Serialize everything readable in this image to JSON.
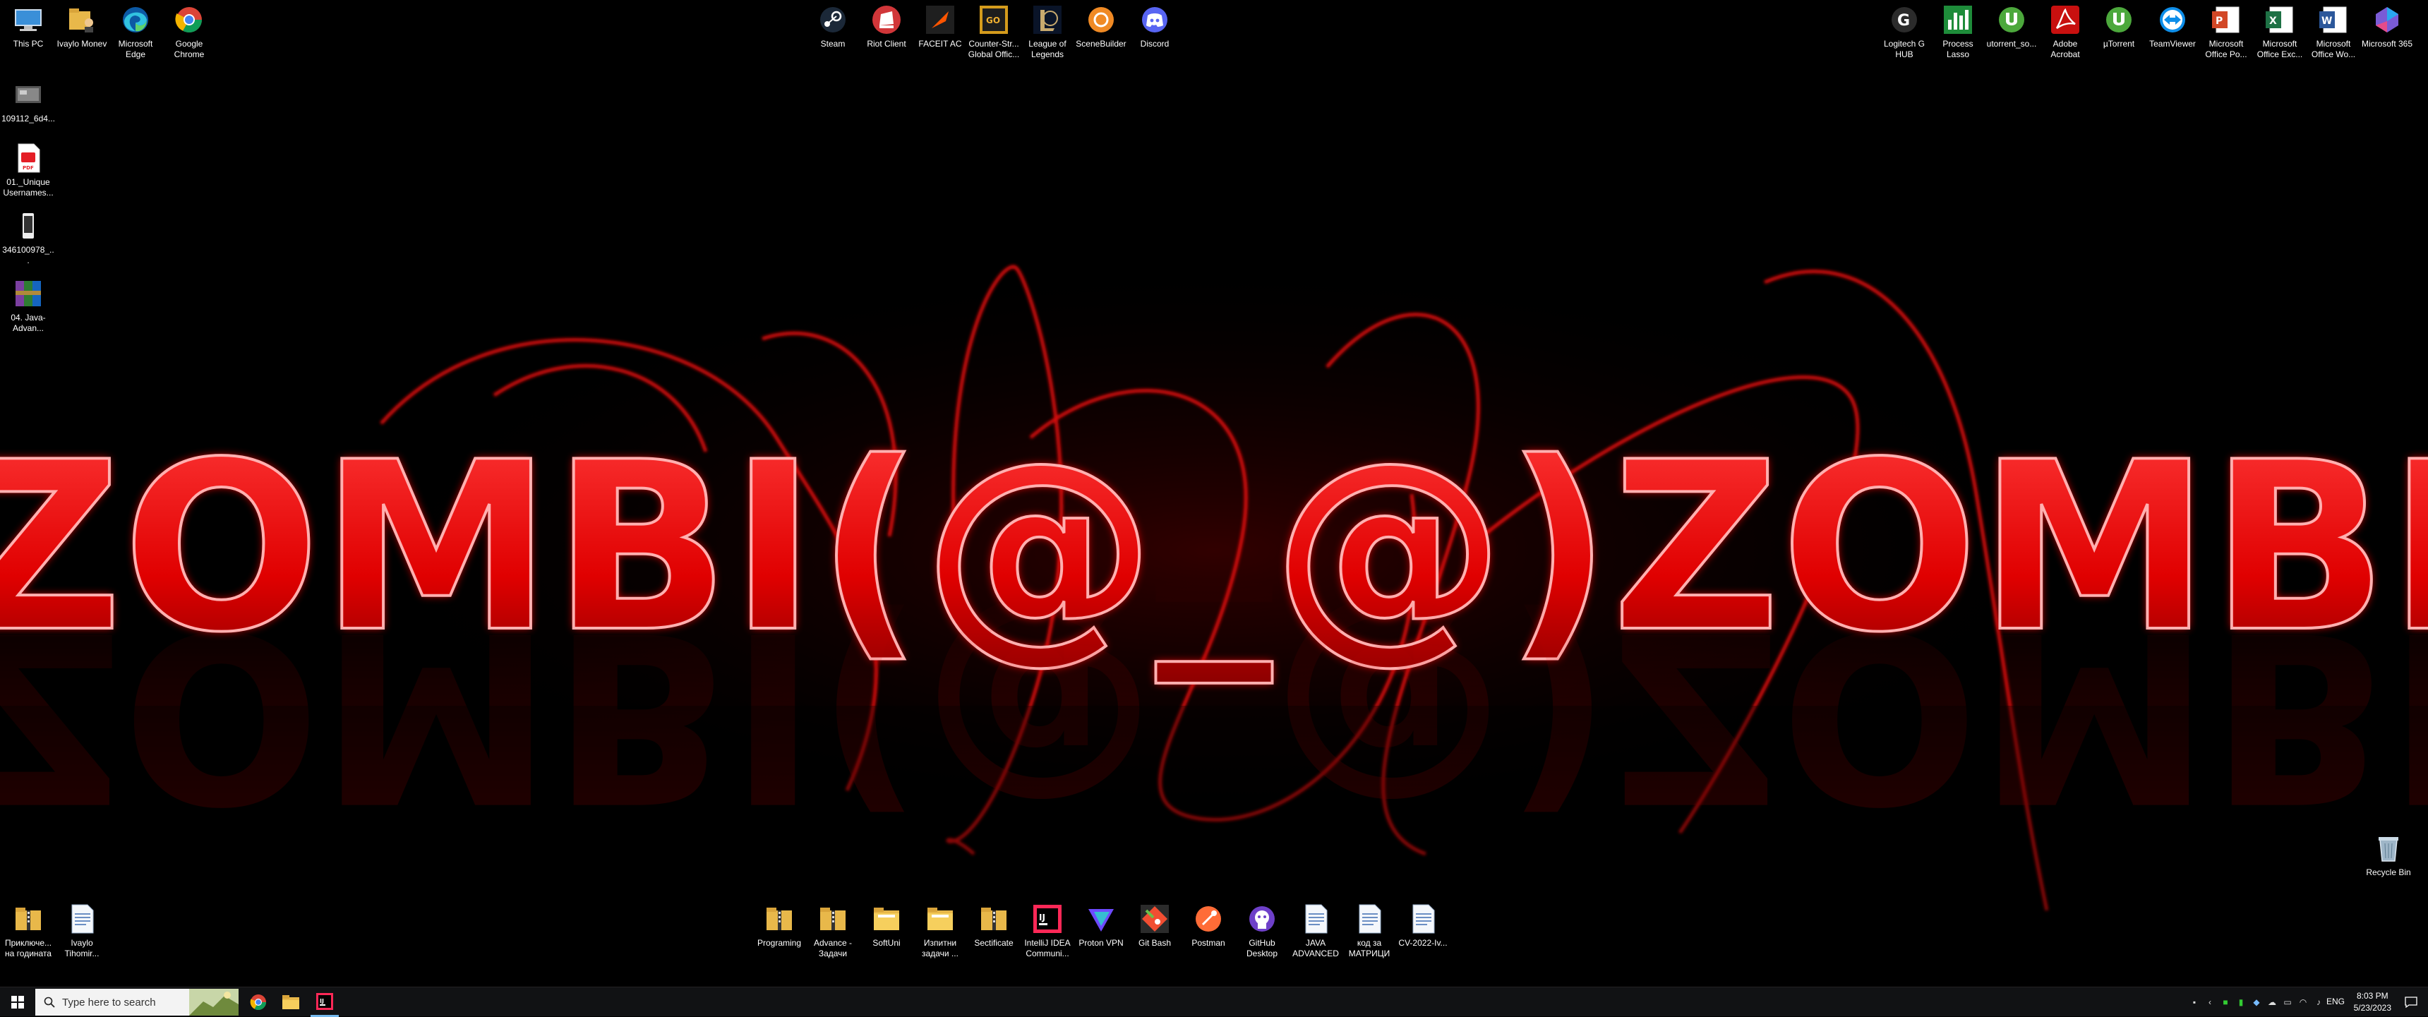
{
  "top_left_icons": [
    {
      "label": "This PC",
      "icon": "monitor-icon"
    },
    {
      "label": "Ivaylo Monev",
      "icon": "user-folder-icon"
    },
    {
      "label": "Microsoft Edge",
      "icon": "edge-icon"
    },
    {
      "label": "Google Chrome",
      "icon": "chrome-icon"
    }
  ],
  "left_column_icons": [
    {
      "label": "109112_6d4...",
      "icon": "image-file-icon"
    },
    {
      "label": "01._Unique Usernames...",
      "icon": "pdf-icon"
    },
    {
      "label": "346100978_...",
      "icon": "phone-image-icon"
    },
    {
      "label": "04. Java-Advan...",
      "icon": "winrar-icon"
    }
  ],
  "top_center_icons": [
    {
      "label": "Steam",
      "icon": "steam-icon"
    },
    {
      "label": "Riot Client",
      "icon": "riot-icon"
    },
    {
      "label": "FACEIT AC",
      "icon": "faceit-icon"
    },
    {
      "label": "Counter-Str... Global Offic...",
      "icon": "csgo-icon"
    },
    {
      "label": "League of Legends",
      "icon": "lol-icon"
    },
    {
      "label": "SceneBuilder",
      "icon": "scenebuilder-icon"
    },
    {
      "label": "Discord",
      "icon": "discord-icon"
    }
  ],
  "top_right_icons": [
    {
      "label": "Logitech G HUB",
      "icon": "logitech-icon"
    },
    {
      "label": "Process Lasso",
      "icon": "process-lasso-icon"
    },
    {
      "label": "utorrent_so...",
      "icon": "utorrent-icon"
    },
    {
      "label": "Adobe Acrobat",
      "icon": "acrobat-icon"
    },
    {
      "label": "µTorrent",
      "icon": "utorrent-icon"
    },
    {
      "label": "TeamViewer",
      "icon": "teamviewer-icon"
    },
    {
      "label": "Microsoft Office Po...",
      "icon": "powerpoint-icon"
    },
    {
      "label": "Microsoft Office Exc...",
      "icon": "excel-icon"
    },
    {
      "label": "Microsoft Office Wo...",
      "icon": "word-icon"
    },
    {
      "label": "Microsoft 365",
      "icon": "m365-icon"
    }
  ],
  "recycle_bin": {
    "label": "Recycle Bin",
    "icon": "recycle-bin-icon"
  },
  "bottom_left_icons": [
    {
      "label": "Приключе... на годината",
      "icon": "zip-folder-icon"
    },
    {
      "label": "Ivaylo Tihomir...",
      "icon": "doc-file-icon"
    }
  ],
  "bottom_center_icons": [
    {
      "label": "Programing",
      "icon": "zip-folder-icon"
    },
    {
      "label": "Advance - Задачи",
      "icon": "zip-folder-icon"
    },
    {
      "label": "SoftUni",
      "icon": "folder-icon"
    },
    {
      "label": "Изпитни задачи ...",
      "icon": "folder-icon"
    },
    {
      "label": "Sectificate",
      "icon": "zip-folder-icon"
    },
    {
      "label": "IntelliJ IDEA Communi...",
      "icon": "intellij-icon"
    },
    {
      "label": "Proton VPN",
      "icon": "protonvpn-icon"
    },
    {
      "label": "Git Bash",
      "icon": "gitbash-icon"
    },
    {
      "label": "Postman",
      "icon": "postman-icon"
    },
    {
      "label": "GitHub Desktop",
      "icon": "github-icon"
    },
    {
      "label": "JAVA ADVANCED",
      "icon": "doc-file-icon"
    },
    {
      "label": "код за МАТРИЦИ",
      "icon": "doc-file-icon"
    },
    {
      "label": "CV-2022-Iv...",
      "icon": "doc-file-icon"
    }
  ],
  "wallpaper": {
    "text": "ZOMBI(@_@)ZOMBI",
    "color": "#e00000"
  },
  "taskbar": {
    "search_placeholder": "Type here to search",
    "pinned": [
      {
        "icon": "chrome-icon"
      },
      {
        "icon": "file-explorer-icon"
      },
      {
        "icon": "intellij-icon"
      }
    ],
    "language": "ENG",
    "time": "8:03 PM",
    "date": "5/23/2023"
  }
}
